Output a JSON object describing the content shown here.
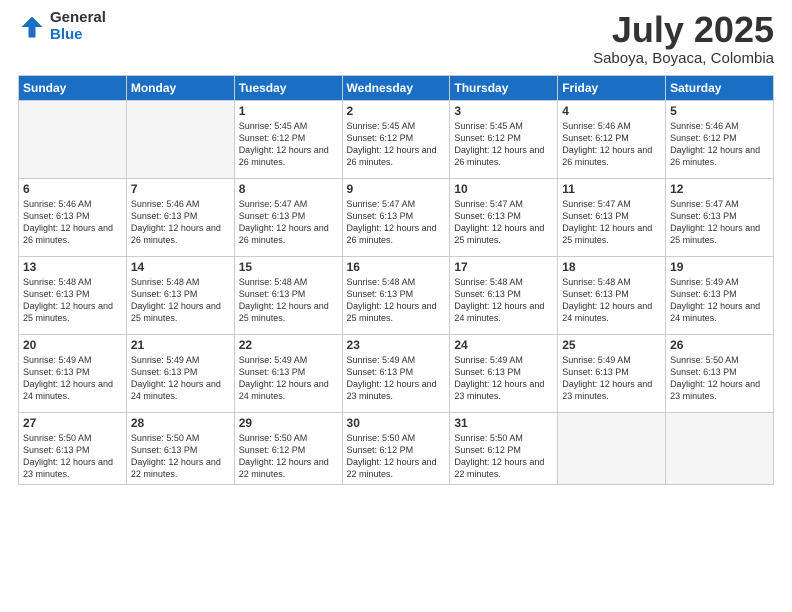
{
  "logo": {
    "general": "General",
    "blue": "Blue"
  },
  "header": {
    "month": "July 2025",
    "location": "Saboya, Boyaca, Colombia"
  },
  "weekdays": [
    "Sunday",
    "Monday",
    "Tuesday",
    "Wednesday",
    "Thursday",
    "Friday",
    "Saturday"
  ],
  "weeks": [
    [
      {
        "day": "",
        "info": ""
      },
      {
        "day": "",
        "info": ""
      },
      {
        "day": "1",
        "info": "Sunrise: 5:45 AM\nSunset: 6:12 PM\nDaylight: 12 hours and 26 minutes."
      },
      {
        "day": "2",
        "info": "Sunrise: 5:45 AM\nSunset: 6:12 PM\nDaylight: 12 hours and 26 minutes."
      },
      {
        "day": "3",
        "info": "Sunrise: 5:45 AM\nSunset: 6:12 PM\nDaylight: 12 hours and 26 minutes."
      },
      {
        "day": "4",
        "info": "Sunrise: 5:46 AM\nSunset: 6:12 PM\nDaylight: 12 hours and 26 minutes."
      },
      {
        "day": "5",
        "info": "Sunrise: 5:46 AM\nSunset: 6:12 PM\nDaylight: 12 hours and 26 minutes."
      }
    ],
    [
      {
        "day": "6",
        "info": "Sunrise: 5:46 AM\nSunset: 6:13 PM\nDaylight: 12 hours and 26 minutes."
      },
      {
        "day": "7",
        "info": "Sunrise: 5:46 AM\nSunset: 6:13 PM\nDaylight: 12 hours and 26 minutes."
      },
      {
        "day": "8",
        "info": "Sunrise: 5:47 AM\nSunset: 6:13 PM\nDaylight: 12 hours and 26 minutes."
      },
      {
        "day": "9",
        "info": "Sunrise: 5:47 AM\nSunset: 6:13 PM\nDaylight: 12 hours and 26 minutes."
      },
      {
        "day": "10",
        "info": "Sunrise: 5:47 AM\nSunset: 6:13 PM\nDaylight: 12 hours and 25 minutes."
      },
      {
        "day": "11",
        "info": "Sunrise: 5:47 AM\nSunset: 6:13 PM\nDaylight: 12 hours and 25 minutes."
      },
      {
        "day": "12",
        "info": "Sunrise: 5:47 AM\nSunset: 6:13 PM\nDaylight: 12 hours and 25 minutes."
      }
    ],
    [
      {
        "day": "13",
        "info": "Sunrise: 5:48 AM\nSunset: 6:13 PM\nDaylight: 12 hours and 25 minutes."
      },
      {
        "day": "14",
        "info": "Sunrise: 5:48 AM\nSunset: 6:13 PM\nDaylight: 12 hours and 25 minutes."
      },
      {
        "day": "15",
        "info": "Sunrise: 5:48 AM\nSunset: 6:13 PM\nDaylight: 12 hours and 25 minutes."
      },
      {
        "day": "16",
        "info": "Sunrise: 5:48 AM\nSunset: 6:13 PM\nDaylight: 12 hours and 25 minutes."
      },
      {
        "day": "17",
        "info": "Sunrise: 5:48 AM\nSunset: 6:13 PM\nDaylight: 12 hours and 24 minutes."
      },
      {
        "day": "18",
        "info": "Sunrise: 5:48 AM\nSunset: 6:13 PM\nDaylight: 12 hours and 24 minutes."
      },
      {
        "day": "19",
        "info": "Sunrise: 5:49 AM\nSunset: 6:13 PM\nDaylight: 12 hours and 24 minutes."
      }
    ],
    [
      {
        "day": "20",
        "info": "Sunrise: 5:49 AM\nSunset: 6:13 PM\nDaylight: 12 hours and 24 minutes."
      },
      {
        "day": "21",
        "info": "Sunrise: 5:49 AM\nSunset: 6:13 PM\nDaylight: 12 hours and 24 minutes."
      },
      {
        "day": "22",
        "info": "Sunrise: 5:49 AM\nSunset: 6:13 PM\nDaylight: 12 hours and 24 minutes."
      },
      {
        "day": "23",
        "info": "Sunrise: 5:49 AM\nSunset: 6:13 PM\nDaylight: 12 hours and 23 minutes."
      },
      {
        "day": "24",
        "info": "Sunrise: 5:49 AM\nSunset: 6:13 PM\nDaylight: 12 hours and 23 minutes."
      },
      {
        "day": "25",
        "info": "Sunrise: 5:49 AM\nSunset: 6:13 PM\nDaylight: 12 hours and 23 minutes."
      },
      {
        "day": "26",
        "info": "Sunrise: 5:50 AM\nSunset: 6:13 PM\nDaylight: 12 hours and 23 minutes."
      }
    ],
    [
      {
        "day": "27",
        "info": "Sunrise: 5:50 AM\nSunset: 6:13 PM\nDaylight: 12 hours and 23 minutes."
      },
      {
        "day": "28",
        "info": "Sunrise: 5:50 AM\nSunset: 6:13 PM\nDaylight: 12 hours and 22 minutes."
      },
      {
        "day": "29",
        "info": "Sunrise: 5:50 AM\nSunset: 6:12 PM\nDaylight: 12 hours and 22 minutes."
      },
      {
        "day": "30",
        "info": "Sunrise: 5:50 AM\nSunset: 6:12 PM\nDaylight: 12 hours and 22 minutes."
      },
      {
        "day": "31",
        "info": "Sunrise: 5:50 AM\nSunset: 6:12 PM\nDaylight: 12 hours and 22 minutes."
      },
      {
        "day": "",
        "info": ""
      },
      {
        "day": "",
        "info": ""
      }
    ]
  ]
}
